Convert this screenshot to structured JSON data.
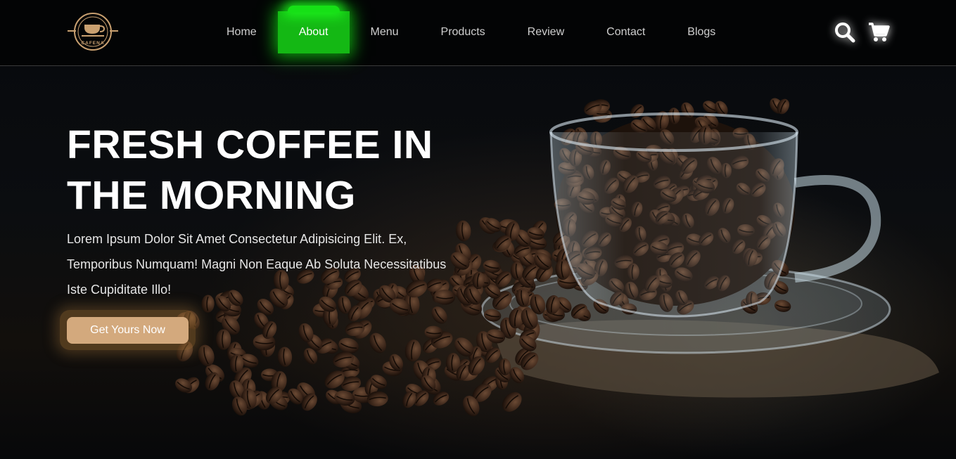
{
  "brand": {
    "logo_text": "CAFENA"
  },
  "nav": {
    "items": [
      {
        "label": "Home"
      },
      {
        "label": "About"
      },
      {
        "label": "Menu"
      },
      {
        "label": "Products"
      },
      {
        "label": "Review"
      },
      {
        "label": "Contact"
      },
      {
        "label": "Blogs"
      }
    ],
    "active_label": "About"
  },
  "header_icons": [
    "search-icon",
    "cart-icon"
  ],
  "hero": {
    "title_line1": "FRESH COFFEE IN",
    "title_line2": "THE MORNING",
    "description_line1": "Lorem Ipsum Dolor Sit Amet Consectetur Adipisicing Elit. Ex,",
    "description_line2": "Temporibus Numquam! Magni Non Eaque Ab Soluta Necessitatibus",
    "description_line3": "Iste Cupiditate Illo!",
    "cta_label": "Get Yours Now"
  },
  "colors": {
    "active_nav": "#14b814",
    "cta": "#d3a97d",
    "logo": "#c9a070",
    "background": "#06080b"
  }
}
